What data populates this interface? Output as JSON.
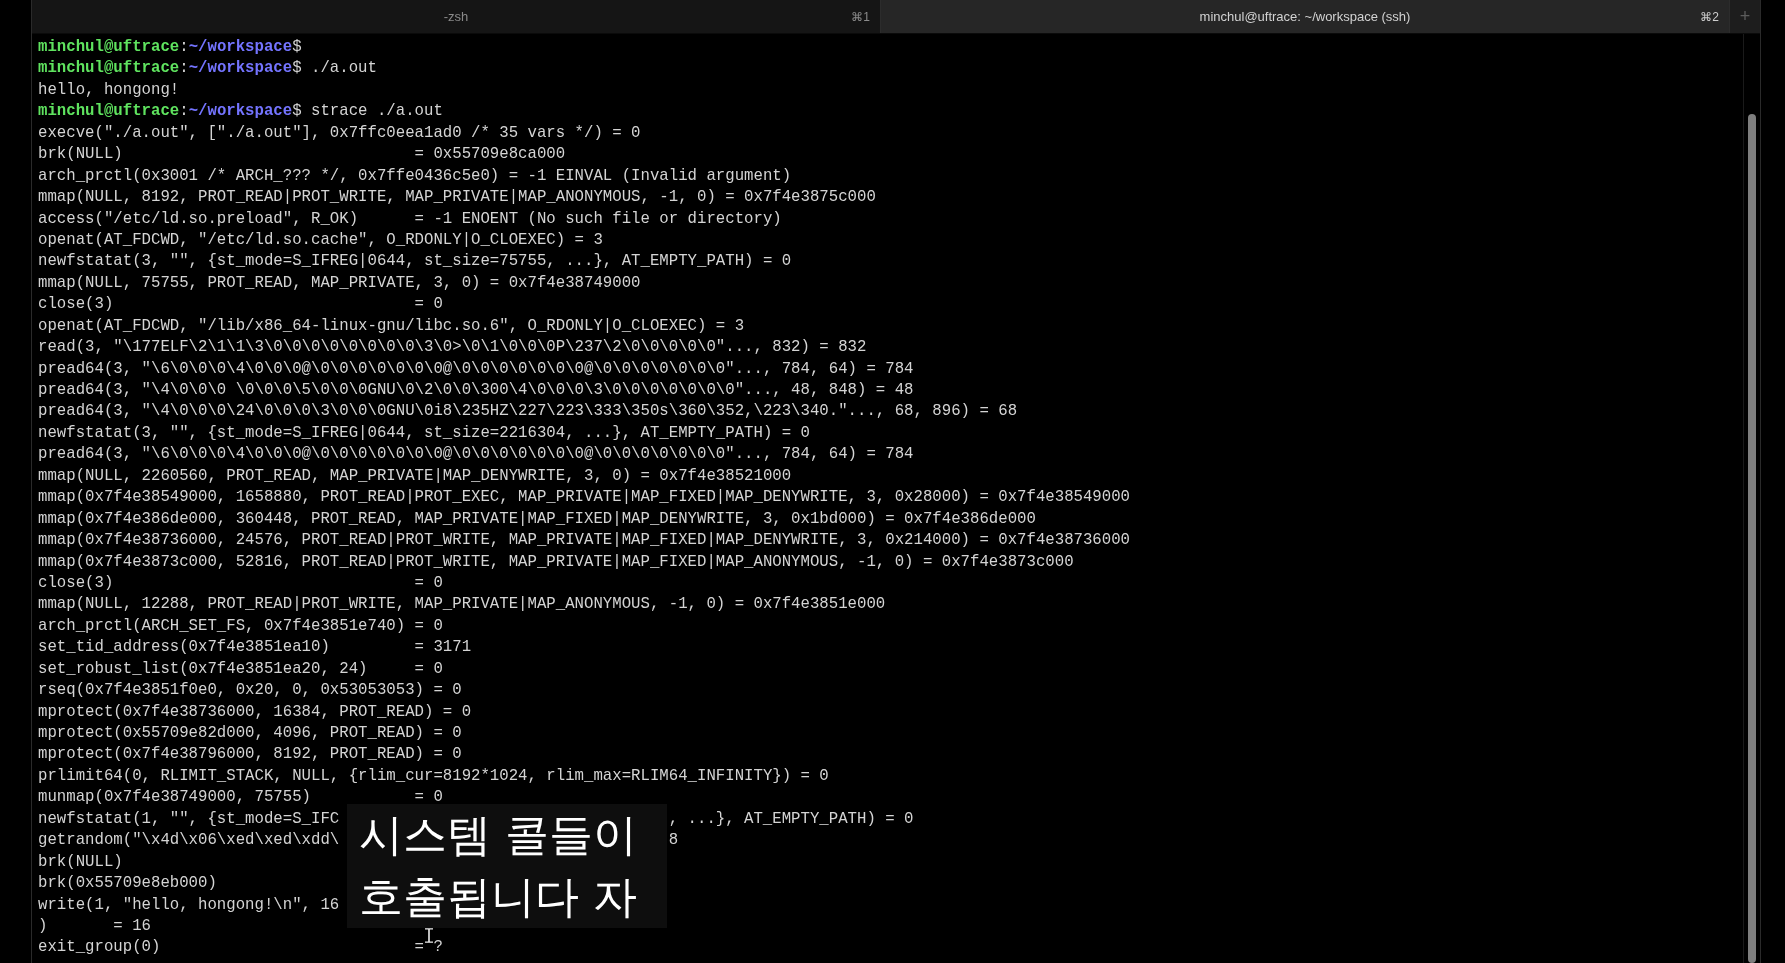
{
  "tabs": [
    {
      "title": "-zsh",
      "shortcut": "⌘1",
      "selected": false
    },
    {
      "title": "minchul@uftrace: ~/workspace (ssh)",
      "shortcut": "⌘2",
      "selected": true
    }
  ],
  "new_tab_button": "+",
  "terminal": {
    "lines": [
      {
        "kind": "prompt",
        "user": "minchul@uftrace",
        "separator": ":",
        "path": "~/workspace",
        "sigil": "$"
      },
      {
        "kind": "prompt",
        "user": "minchul@uftrace",
        "separator": ":",
        "path": "~/workspace",
        "sigil": "$",
        "command": "./a.out"
      },
      {
        "kind": "output",
        "text": "hello, hongong!"
      },
      {
        "kind": "prompt",
        "user": "minchul@uftrace",
        "separator": ":",
        "path": "~/workspace",
        "sigil": "$",
        "command": "strace ./a.out"
      },
      {
        "kind": "output",
        "text": "execve(\"./a.out\", [\"./a.out\"], 0x7ffc0eea1ad0 /* 35 vars */) = 0"
      },
      {
        "kind": "output",
        "text": "brk(NULL)                               = 0x55709e8ca000"
      },
      {
        "kind": "output",
        "text": "arch_prctl(0x3001 /* ARCH_??? */, 0x7ffe0436c5e0) = -1 EINVAL (Invalid argument)"
      },
      {
        "kind": "output",
        "text": "mmap(NULL, 8192, PROT_READ|PROT_WRITE, MAP_PRIVATE|MAP_ANONYMOUS, -1, 0) = 0x7f4e3875c000"
      },
      {
        "kind": "output",
        "text": "access(\"/etc/ld.so.preload\", R_OK)      = -1 ENOENT (No such file or directory)"
      },
      {
        "kind": "output",
        "text": "openat(AT_FDCWD, \"/etc/ld.so.cache\", O_RDONLY|O_CLOEXEC) = 3"
      },
      {
        "kind": "output",
        "text": "newfstatat(3, \"\", {st_mode=S_IFREG|0644, st_size=75755, ...}, AT_EMPTY_PATH) = 0"
      },
      {
        "kind": "output",
        "text": "mmap(NULL, 75755, PROT_READ, MAP_PRIVATE, 3, 0) = 0x7f4e38749000"
      },
      {
        "kind": "output",
        "text": "close(3)                                = 0"
      },
      {
        "kind": "output",
        "text": "openat(AT_FDCWD, \"/lib/x86_64-linux-gnu/libc.so.6\", O_RDONLY|O_CLOEXEC) = 3"
      },
      {
        "kind": "output",
        "text": "read(3, \"\\177ELF\\2\\1\\1\\3\\0\\0\\0\\0\\0\\0\\0\\0\\3\\0>\\0\\1\\0\\0\\0P\\237\\2\\0\\0\\0\\0\\0\"..., 832) = 832"
      },
      {
        "kind": "output",
        "text": "pread64(3, \"\\6\\0\\0\\0\\4\\0\\0\\0@\\0\\0\\0\\0\\0\\0\\0@\\0\\0\\0\\0\\0\\0\\0@\\0\\0\\0\\0\\0\\0\\0\"..., 784, 64) = 784"
      },
      {
        "kind": "output",
        "text": "pread64(3, \"\\4\\0\\0\\0 \\0\\0\\0\\5\\0\\0\\0GNU\\0\\2\\0\\0\\300\\4\\0\\0\\0\\3\\0\\0\\0\\0\\0\\0\\0\"..., 48, 848) = 48"
      },
      {
        "kind": "output",
        "text": "pread64(3, \"\\4\\0\\0\\0\\24\\0\\0\\0\\3\\0\\0\\0GNU\\0i8\\235HZ\\227\\223\\333\\350s\\360\\352,\\223\\340.\"..., 68, 896) = 68"
      },
      {
        "kind": "output",
        "text": "newfstatat(3, \"\", {st_mode=S_IFREG|0644, st_size=2216304, ...}, AT_EMPTY_PATH) = 0"
      },
      {
        "kind": "output",
        "text": "pread64(3, \"\\6\\0\\0\\0\\4\\0\\0\\0@\\0\\0\\0\\0\\0\\0\\0@\\0\\0\\0\\0\\0\\0\\0@\\0\\0\\0\\0\\0\\0\\0\"..., 784, 64) = 784"
      },
      {
        "kind": "output",
        "text": "mmap(NULL, 2260560, PROT_READ, MAP_PRIVATE|MAP_DENYWRITE, 3, 0) = 0x7f4e38521000"
      },
      {
        "kind": "output",
        "text": "mmap(0x7f4e38549000, 1658880, PROT_READ|PROT_EXEC, MAP_PRIVATE|MAP_FIXED|MAP_DENYWRITE, 3, 0x28000) = 0x7f4e38549000"
      },
      {
        "kind": "output",
        "text": "mmap(0x7f4e386de000, 360448, PROT_READ, MAP_PRIVATE|MAP_FIXED|MAP_DENYWRITE, 3, 0x1bd000) = 0x7f4e386de000"
      },
      {
        "kind": "output",
        "text": "mmap(0x7f4e38736000, 24576, PROT_READ|PROT_WRITE, MAP_PRIVATE|MAP_FIXED|MAP_DENYWRITE, 3, 0x214000) = 0x7f4e38736000"
      },
      {
        "kind": "output",
        "text": "mmap(0x7f4e3873c000, 52816, PROT_READ|PROT_WRITE, MAP_PRIVATE|MAP_FIXED|MAP_ANONYMOUS, -1, 0) = 0x7f4e3873c000"
      },
      {
        "kind": "output",
        "text": "close(3)                                = 0"
      },
      {
        "kind": "output",
        "text": "mmap(NULL, 12288, PROT_READ|PROT_WRITE, MAP_PRIVATE|MAP_ANONYMOUS, -1, 0) = 0x7f4e3851e000"
      },
      {
        "kind": "output",
        "text": "arch_prctl(ARCH_SET_FS, 0x7f4e3851e740) = 0"
      },
      {
        "kind": "output",
        "text": "set_tid_address(0x7f4e3851ea10)         = 3171"
      },
      {
        "kind": "output",
        "text": "set_robust_list(0x7f4e3851ea20, 24)     = 0"
      },
      {
        "kind": "output",
        "text": "rseq(0x7f4e3851f0e0, 0x20, 0, 0x53053053) = 0"
      },
      {
        "kind": "output",
        "text": "mprotect(0x7f4e38736000, 16384, PROT_READ) = 0"
      },
      {
        "kind": "output",
        "text": "mprotect(0x55709e82d000, 4096, PROT_READ) = 0"
      },
      {
        "kind": "output",
        "text": "mprotect(0x7f4e38796000, 8192, PROT_READ) = 0"
      },
      {
        "kind": "output",
        "text": "prlimit64(0, RLIMIT_STACK, NULL, {rlim_cur=8192*1024, rlim_max=RLIM64_INFINITY}) = 0"
      },
      {
        "kind": "output",
        "text": "munmap(0x7f4e38749000, 75755)           = 0"
      },
      {
        "kind": "covered",
        "text": "newfstatat(1, \"\", {st_mode=S_IFC",
        "tail": ", ...}, AT_EMPTY_PATH) = 0"
      },
      {
        "kind": "covered",
        "text": "getrandom(\"\\x4d\\x06\\xed\\xed\\xdd\\",
        "tail": "8"
      },
      {
        "kind": "output",
        "text": "brk(NULL)"
      },
      {
        "kind": "output",
        "text": "brk(0x55709e8eb000)"
      },
      {
        "kind": "output",
        "text": "write(1, \"hello, hongong!\\n\", 16"
      },
      {
        "kind": "output",
        "text": ")       = 16"
      },
      {
        "kind": "output",
        "text": "exit_group(0)                           = ?"
      }
    ]
  },
  "subtitle": {
    "lines": [
      "시스템 콜들이",
      "호출됩니다 자"
    ]
  }
}
